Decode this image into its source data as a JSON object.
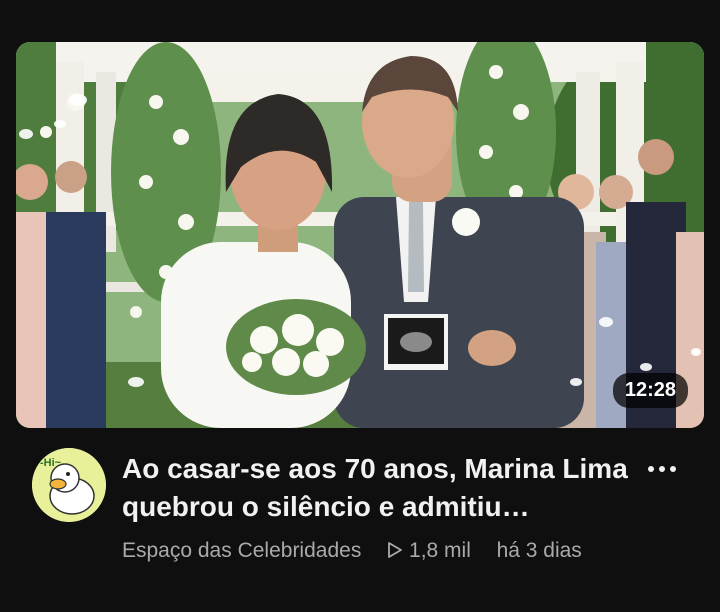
{
  "video": {
    "duration": "12:28",
    "title": "Ao casar-se aos 70 anos, Marina Lima quebrou o silêncio e admitiu…",
    "channel": "Espaço das Celebridades",
    "views": "1,8 mil",
    "age": "há 3 dias"
  },
  "icons": {
    "more": "more-vertical-icon",
    "views": "play-outline-icon"
  },
  "colors": {
    "background": "#0f0f0f",
    "title": "#f1f1f1",
    "meta": "#aaaaaa",
    "avatar_bg": "#e8f19a"
  }
}
